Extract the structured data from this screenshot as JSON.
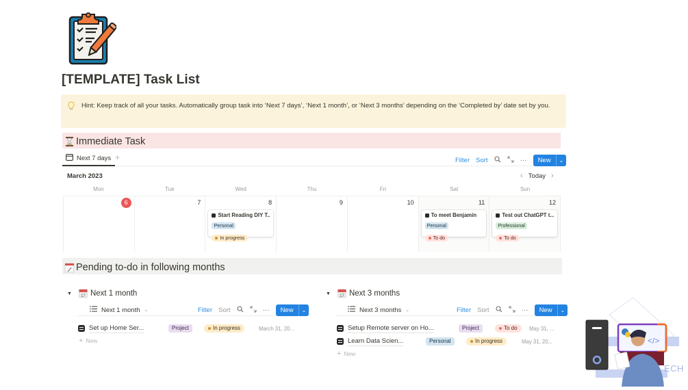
{
  "page": {
    "title": "[TEMPLATE] Task List",
    "icon": "clipboard-checklist-icon"
  },
  "callout": {
    "icon": "lightbulb-icon",
    "text": "Hint: Keep track of all your tasks. Automatically group task into ‘Next 7 days’, ‘Next 1 month’, or ‘Next 3 months’ depending on the ‘Completed by’ date set by you."
  },
  "immediate": {
    "heading": "Immediate Task",
    "heading_icon": "hourglass-icon",
    "view_tab": "Next 7 days",
    "toolbar": {
      "filter": "Filter",
      "sort": "Sort",
      "new": "New"
    },
    "month": "March 2023",
    "today_label": "Today",
    "weekdays": [
      "Mon",
      "Tue",
      "Wed",
      "Thu",
      "Fri",
      "Sat",
      "Sun"
    ],
    "days": [
      {
        "num": "6",
        "today": true
      },
      {
        "num": "7"
      },
      {
        "num": "8",
        "card": {
          "title": "Start Reading DIY T...",
          "tag": "Personal",
          "status": "In progress"
        }
      },
      {
        "num": "9"
      },
      {
        "num": "10"
      },
      {
        "num": "11",
        "card": {
          "title": "To meet Benjamin",
          "tag": "Personal",
          "status": "To do"
        }
      },
      {
        "num": "12",
        "card": {
          "title": "Test out ChatGPT t...",
          "tag": "Professional",
          "status": "To do"
        }
      }
    ]
  },
  "pending": {
    "heading": "Pending to-do in following months",
    "heading_icon": "calendar-spiral-icon",
    "groups": [
      {
        "title": "Next 1 month",
        "view_tab": "Next 1 month",
        "toolbar": {
          "filter": "Filter",
          "sort": "Sort",
          "new": "New"
        },
        "rows": [
          {
            "title": "Set up Home Ser...",
            "tag": "Project",
            "status": "In progress",
            "date": "March 31, 20..."
          }
        ],
        "add_new": "New"
      },
      {
        "title": "Next 3 months",
        "view_tab": "Next 3 months",
        "toolbar": {
          "filter": "Filter",
          "sort": "Sort",
          "new": "New"
        },
        "rows": [
          {
            "title": "Setup Remote server on Ho...",
            "tag": "Project",
            "status": "To do",
            "date": "May 31, ..."
          },
          {
            "title": "Learn Data Scien...",
            "tag": "Personal",
            "status": "In progress",
            "date": "May 31, 20..."
          }
        ],
        "add_new": "New"
      }
    ]
  },
  "watermark": {
    "text": "ECH"
  },
  "colors": {
    "accent": "#2383e2",
    "callout_bg": "#fbf3db",
    "immediate_bg": "#fbe4e4",
    "pending_bg": "#f1f1ef",
    "today": "#eb5757"
  }
}
